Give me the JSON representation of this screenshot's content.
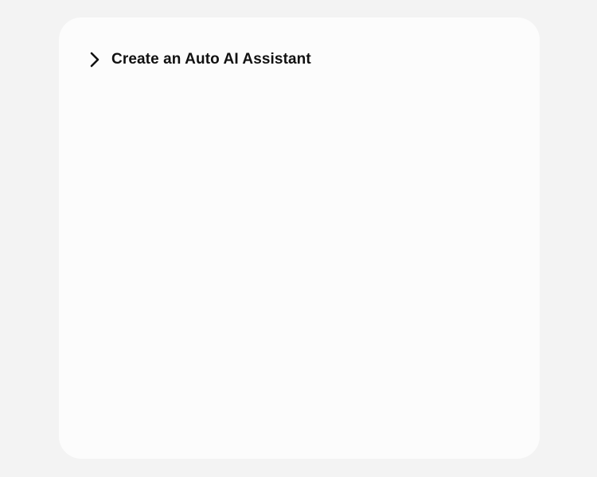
{
  "card": {
    "title": "Create an Auto AI Assistant",
    "expand_icon": "chevron-right-icon"
  },
  "colors": {
    "background": "#f3f3f3",
    "card": "#fcfcfc",
    "text": "#111111"
  }
}
